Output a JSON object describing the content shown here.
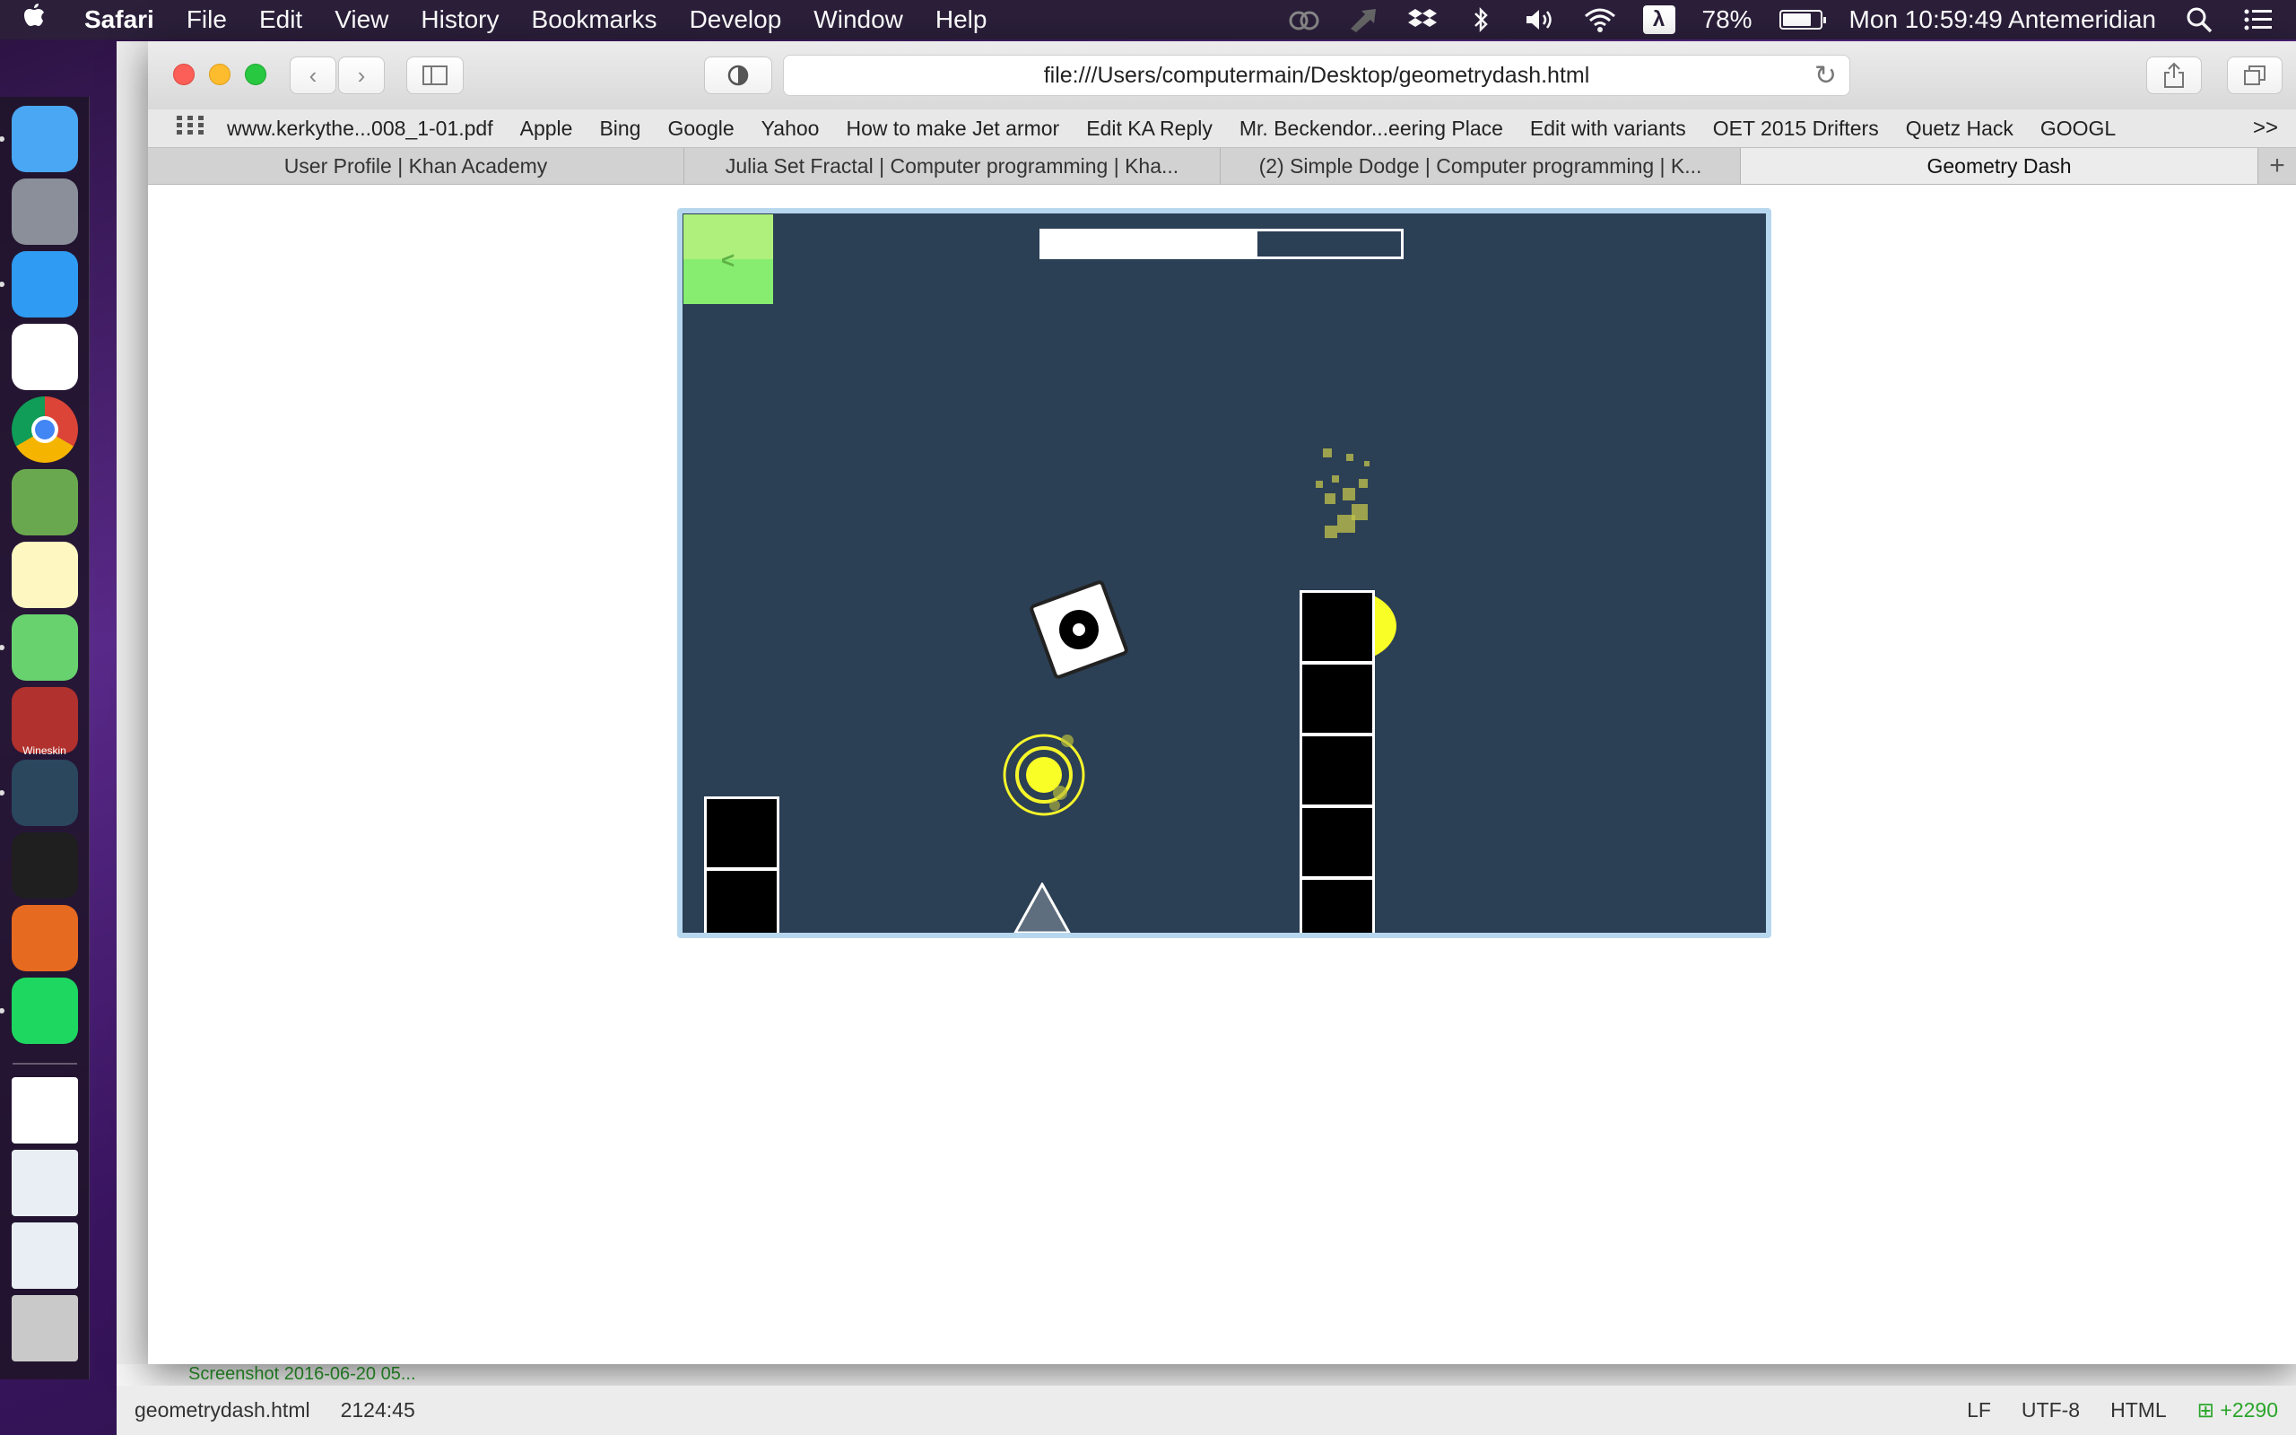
{
  "menubar": {
    "app_name": "Safari",
    "items": [
      "File",
      "Edit",
      "View",
      "History",
      "Bookmarks",
      "Develop",
      "Window",
      "Help"
    ],
    "battery_percent": "78%",
    "battery_level": 0.78,
    "clock": "Mon 10:59:49 Antemeridian",
    "status_icons": [
      "creative-cloud-icon",
      "arrow-icon",
      "dropbox-icon",
      "bluetooth-icon",
      "volume-icon",
      "wifi-icon",
      "lambda-icon",
      "battery-icon",
      "spotlight-icon",
      "notification-center-icon"
    ]
  },
  "dock": {
    "apps": [
      {
        "name": "finder",
        "color": "#4aa7f3",
        "running": true
      },
      {
        "name": "launchpad",
        "color": "#8a8f99",
        "running": false
      },
      {
        "name": "safari",
        "color": "#2f9bf2",
        "running": true
      },
      {
        "name": "app-store-grid",
        "color": "#ffffff",
        "running": false
      },
      {
        "name": "chrome",
        "color": "#f2c12e",
        "running": false
      },
      {
        "name": "minecraft",
        "color": "#6aa84f",
        "running": false
      },
      {
        "name": "notes",
        "color": "#fff7c2",
        "running": false
      },
      {
        "name": "atom",
        "color": "#68d26f",
        "running": true
      },
      {
        "name": "wineskin",
        "color": "#b0312d",
        "label": "Wineskin",
        "running": false
      },
      {
        "name": "steam",
        "color": "#2a475e",
        "running": true
      },
      {
        "name": "skull-app",
        "color": "#1f1f1f",
        "running": false
      },
      {
        "name": "firefox",
        "color": "#e66a1f",
        "running": false
      },
      {
        "name": "spotify",
        "color": "#1ed760",
        "running": true
      }
    ],
    "docs": [
      {
        "name": "document",
        "color": "#ffffff"
      },
      {
        "name": "screenshot-stack-1",
        "color": "#e9eef5"
      },
      {
        "name": "screenshot-stack-2",
        "color": "#e9eef5"
      },
      {
        "name": "trash",
        "color": "#c9c9c9"
      }
    ]
  },
  "safari": {
    "url": "file:///Users/computermain/Desktop/geometrydash.html",
    "bookmarks": [
      "www.kerkythe...008_1-01.pdf",
      "Apple",
      "Bing",
      "Google",
      "Yahoo",
      "How to make Jet armor",
      "Edit KA Reply",
      "Mr. Beckendor...eering Place",
      "Edit with variants",
      "OET 2015 Drifters",
      "Quetz Hack",
      "GOOGL"
    ],
    "bookmarks_more": ">>",
    "tabs": [
      {
        "title": "User Profile | Khan Academy",
        "active": false
      },
      {
        "title": "Julia Set Fractal | Computer programming | Kha...",
        "active": false
      },
      {
        "title": "(2) Simple Dodge | Computer programming | K...",
        "active": false
      },
      {
        "title": "Geometry Dash",
        "active": true
      }
    ],
    "new_tab": "+"
  },
  "game": {
    "level_progress": 0.6,
    "colors": {
      "background": "#2b3f55",
      "back_button_top": "#aff07d",
      "back_button_bottom": "#86ed70",
      "pad": "#fafe27",
      "orb": "#f5f52a",
      "particle": "#c3c44b"
    },
    "back_arrow": "<"
  },
  "editor_status": {
    "filename": "geometrydash.html",
    "cursor": "2124:45",
    "line_ending": "LF",
    "encoding": "UTF-8",
    "grammar": "HTML",
    "git_diff": "+2290",
    "behind_file": "Screenshot 2016-06-20 05..."
  }
}
